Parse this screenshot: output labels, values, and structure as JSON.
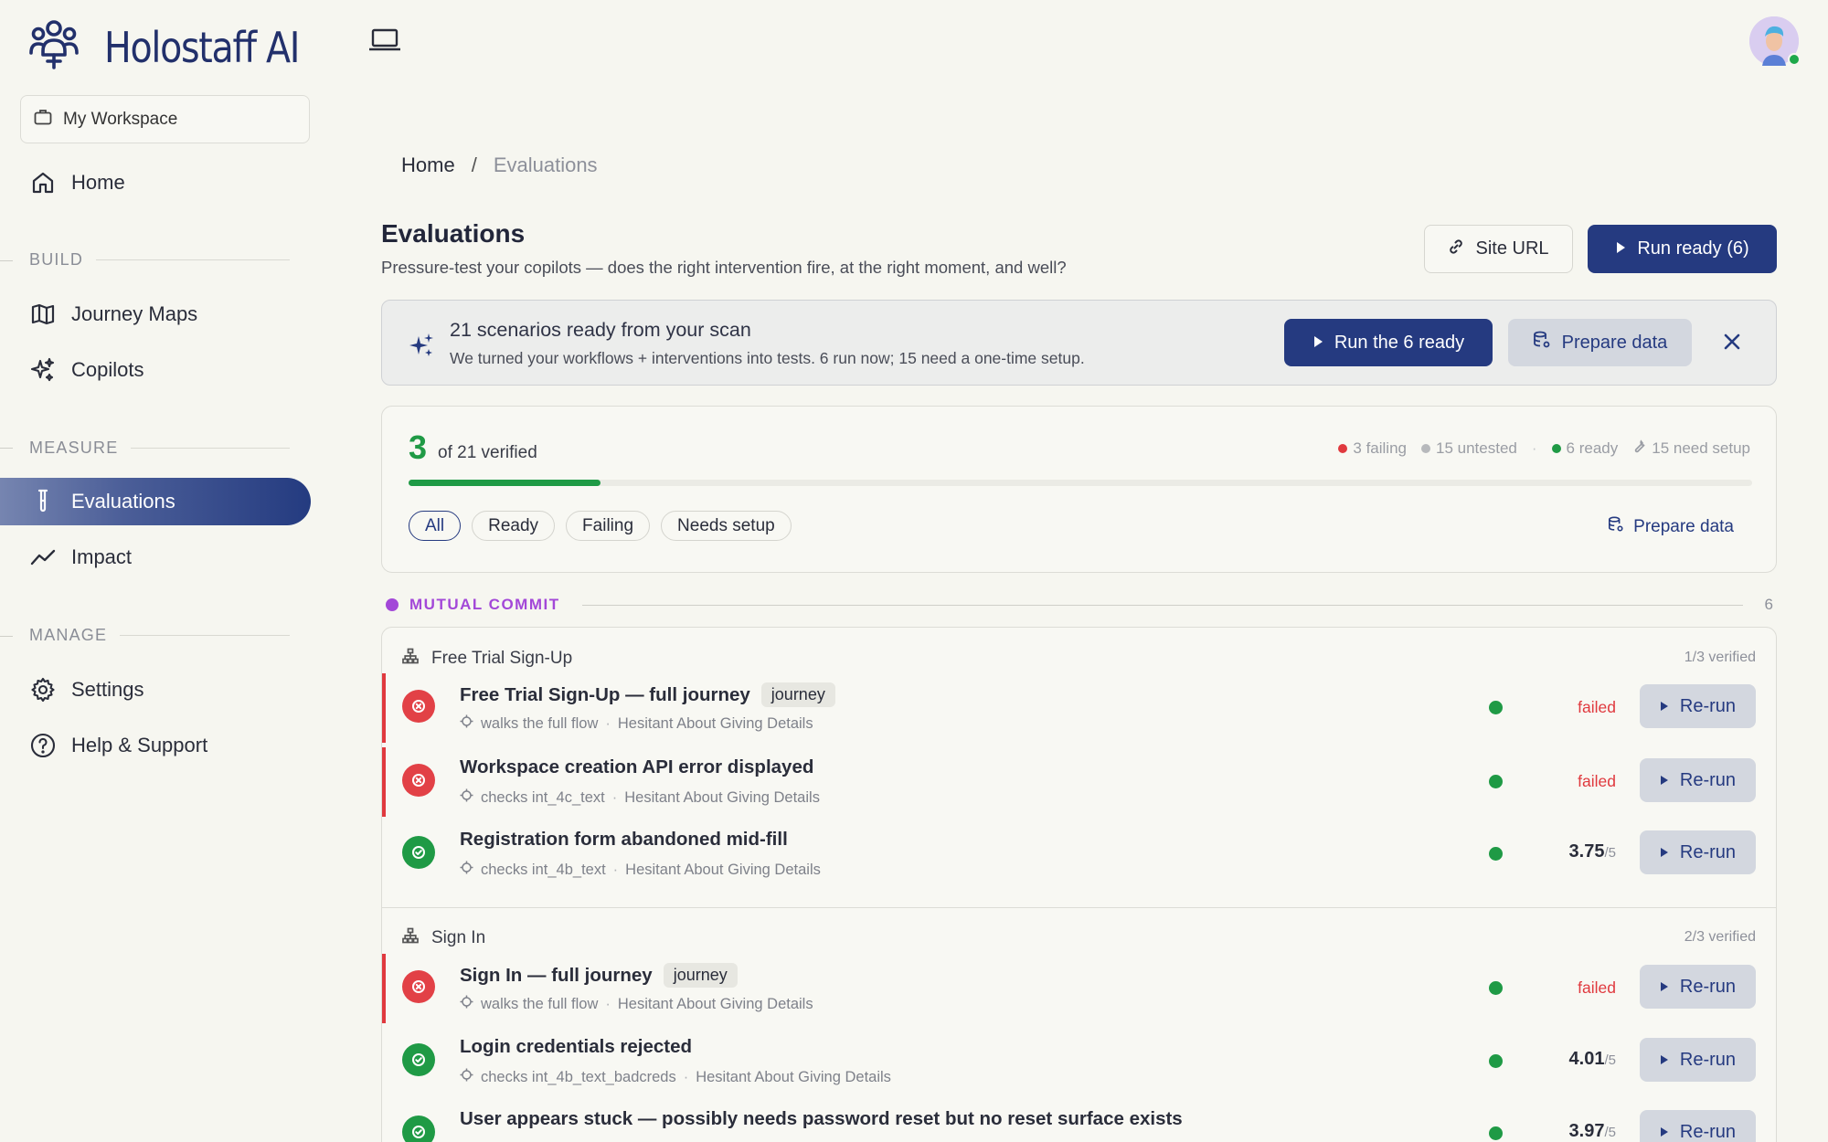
{
  "brand": {
    "name": "Holostaff AI"
  },
  "workspace": {
    "label": "My Workspace"
  },
  "nav": {
    "home": "Home",
    "build_label": "BUILD",
    "journey_maps": "Journey Maps",
    "copilots": "Copilots",
    "measure_label": "MEASURE",
    "evaluations": "Evaluations",
    "impact": "Impact",
    "manage_label": "MANAGE",
    "settings": "Settings",
    "help": "Help & Support"
  },
  "breadcrumb": {
    "home": "Home",
    "sep": "/",
    "current": "Evaluations"
  },
  "header": {
    "title": "Evaluations",
    "subtitle": "Pressure-test your copilots — does the right intervention fire, at the right moment, and well?",
    "site_url": "Site URL",
    "run_ready": "Run ready (6)"
  },
  "banner": {
    "title": "21 scenarios ready from your scan",
    "subtitle": "We turned your workflows + interventions into tests. 6 run now; 15 need a one-time setup.",
    "run_button": "Run the 6 ready",
    "prepare_button": "Prepare data"
  },
  "progress": {
    "verified_count": "3",
    "of_text": "of 21 verified",
    "fraction": 0.1429,
    "failing": "3 failing",
    "untested": "15 untested",
    "sep": "·",
    "ready": "6 ready",
    "need_setup": "15 need setup",
    "filters": [
      "All",
      "Ready",
      "Failing",
      "Needs setup"
    ],
    "prepare_link": "Prepare data"
  },
  "group": {
    "name": "MUTUAL COMMIT",
    "count": "6"
  },
  "flows": [
    {
      "name": "Free Trial Sign-Up",
      "verified": "1/3 verified",
      "rows": [
        {
          "title": "Free Trial Sign-Up — full journey",
          "tag": "journey",
          "meta_a": "walks the full flow",
          "meta_b": "Hesitant About Giving Details",
          "result": "failed",
          "rerun": "Re-run"
        },
        {
          "title": "Workspace creation API error displayed",
          "tag": "",
          "meta_a": "checks int_4c_text",
          "meta_b": "Hesitant About Giving Details",
          "result": "failed",
          "rerun": "Re-run"
        },
        {
          "title": "Registration form abandoned mid-fill",
          "tag": "",
          "meta_a": "checks int_4b_text",
          "meta_b": "Hesitant About Giving Details",
          "score": "3.75",
          "denom": "/5",
          "rerun": "Re-run"
        }
      ]
    },
    {
      "name": "Sign In",
      "verified": "2/3 verified",
      "rows": [
        {
          "title": "Sign In — full journey",
          "tag": "journey",
          "meta_a": "walks the full flow",
          "meta_b": "Hesitant About Giving Details",
          "result": "failed",
          "rerun": "Re-run"
        },
        {
          "title": "Login credentials rejected",
          "tag": "",
          "meta_a": "checks int_4b_text_badcreds",
          "meta_b": "Hesitant About Giving Details",
          "score": "4.01",
          "denom": "/5",
          "rerun": "Re-run"
        },
        {
          "title": "User appears stuck — possibly needs password reset but no reset surface exists",
          "tag": "",
          "meta_a": "",
          "meta_b": "",
          "score": "3.97",
          "denom": "/5",
          "rerun": "Re-run"
        }
      ]
    }
  ],
  "colors": {
    "primary": "#253a80",
    "success": "#1f9a45",
    "danger": "#e0393e",
    "group": "#a348d8"
  }
}
